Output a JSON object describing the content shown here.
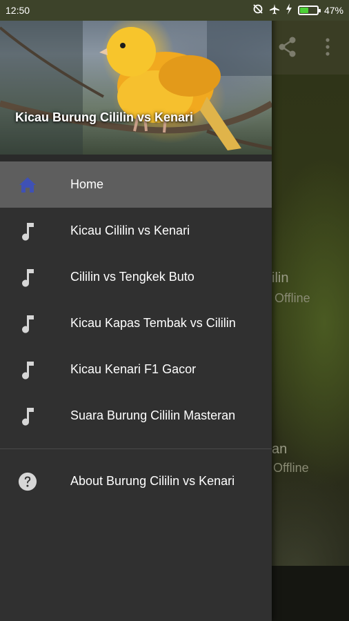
{
  "status_bar": {
    "time": "12:50",
    "battery_text": "47%",
    "battery_level": 0.47,
    "icons": [
      "sync-off-icon",
      "airplane-icon",
      "charging-icon",
      "battery-icon"
    ]
  },
  "background_app": {
    "toolbar_icons": [
      "share-icon",
      "more-vert-icon"
    ],
    "items": [
      {
        "title": "ilin",
        "subtitle": "Offline"
      },
      {
        "title": "an",
        "subtitle": "Offline"
      }
    ]
  },
  "drawer": {
    "header_title": "Kicau Burung Cililin vs Kenari",
    "items": [
      {
        "label": "Home",
        "icon": "home-icon",
        "active": true
      },
      {
        "label": "Kicau Cililin vs Kenari",
        "icon": "music-note-icon",
        "active": false
      },
      {
        "label": "Cililin vs Tengkek Buto",
        "icon": "music-note-icon",
        "active": false
      },
      {
        "label": "Kicau Kapas Tembak vs Cililin",
        "icon": "music-note-icon",
        "active": false
      },
      {
        "label": "Kicau Kenari F1 Gacor",
        "icon": "music-note-icon",
        "active": false
      },
      {
        "label": "Suara Burung Cililin Masteran",
        "icon": "music-note-icon",
        "active": false
      }
    ],
    "about": {
      "label": "About Burung Cililin vs Kenari",
      "icon": "help-circle-icon"
    }
  },
  "colors": {
    "drawer_bg": "#303030",
    "active_row": "#5e5e5e",
    "home_icon": "#3f51b5",
    "icon_gray": "#d6d6d6",
    "text": "#ffffff"
  }
}
